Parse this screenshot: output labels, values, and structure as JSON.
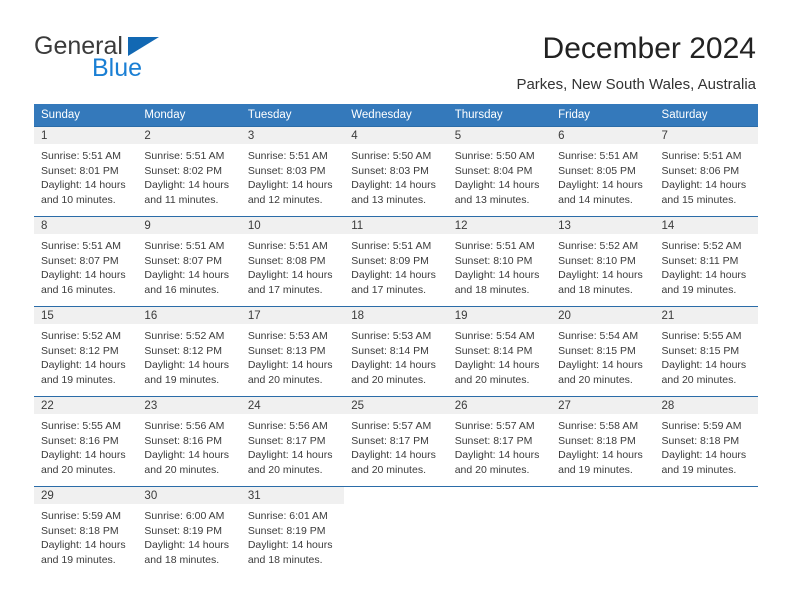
{
  "brand": {
    "name_line1": "General",
    "name_line2": "Blue",
    "flag_icon": "triangle-flag-icon",
    "accent_color": "#1a7fd4"
  },
  "header": {
    "title": "December 2024",
    "subtitle": "Parkes, New South Wales, Australia"
  },
  "theme": {
    "header_row_bg": "#3479bb",
    "day_number_bg": "#f0f0f0",
    "row_border": "#2b6ca8"
  },
  "calendar": {
    "weekday_headers": [
      "Sunday",
      "Monday",
      "Tuesday",
      "Wednesday",
      "Thursday",
      "Friday",
      "Saturday"
    ],
    "weeks": [
      [
        {
          "day": "1",
          "sunrise": "Sunrise: 5:51 AM",
          "sunset": "Sunset: 8:01 PM",
          "daylight_line1": "Daylight: 14 hours",
          "daylight_line2": "and 10 minutes."
        },
        {
          "day": "2",
          "sunrise": "Sunrise: 5:51 AM",
          "sunset": "Sunset: 8:02 PM",
          "daylight_line1": "Daylight: 14 hours",
          "daylight_line2": "and 11 minutes."
        },
        {
          "day": "3",
          "sunrise": "Sunrise: 5:51 AM",
          "sunset": "Sunset: 8:03 PM",
          "daylight_line1": "Daylight: 14 hours",
          "daylight_line2": "and 12 minutes."
        },
        {
          "day": "4",
          "sunrise": "Sunrise: 5:50 AM",
          "sunset": "Sunset: 8:03 PM",
          "daylight_line1": "Daylight: 14 hours",
          "daylight_line2": "and 13 minutes."
        },
        {
          "day": "5",
          "sunrise": "Sunrise: 5:50 AM",
          "sunset": "Sunset: 8:04 PM",
          "daylight_line1": "Daylight: 14 hours",
          "daylight_line2": "and 13 minutes."
        },
        {
          "day": "6",
          "sunrise": "Sunrise: 5:51 AM",
          "sunset": "Sunset: 8:05 PM",
          "daylight_line1": "Daylight: 14 hours",
          "daylight_line2": "and 14 minutes."
        },
        {
          "day": "7",
          "sunrise": "Sunrise: 5:51 AM",
          "sunset": "Sunset: 8:06 PM",
          "daylight_line1": "Daylight: 14 hours",
          "daylight_line2": "and 15 minutes."
        }
      ],
      [
        {
          "day": "8",
          "sunrise": "Sunrise: 5:51 AM",
          "sunset": "Sunset: 8:07 PM",
          "daylight_line1": "Daylight: 14 hours",
          "daylight_line2": "and 16 minutes."
        },
        {
          "day": "9",
          "sunrise": "Sunrise: 5:51 AM",
          "sunset": "Sunset: 8:07 PM",
          "daylight_line1": "Daylight: 14 hours",
          "daylight_line2": "and 16 minutes."
        },
        {
          "day": "10",
          "sunrise": "Sunrise: 5:51 AM",
          "sunset": "Sunset: 8:08 PM",
          "daylight_line1": "Daylight: 14 hours",
          "daylight_line2": "and 17 minutes."
        },
        {
          "day": "11",
          "sunrise": "Sunrise: 5:51 AM",
          "sunset": "Sunset: 8:09 PM",
          "daylight_line1": "Daylight: 14 hours",
          "daylight_line2": "and 17 minutes."
        },
        {
          "day": "12",
          "sunrise": "Sunrise: 5:51 AM",
          "sunset": "Sunset: 8:10 PM",
          "daylight_line1": "Daylight: 14 hours",
          "daylight_line2": "and 18 minutes."
        },
        {
          "day": "13",
          "sunrise": "Sunrise: 5:52 AM",
          "sunset": "Sunset: 8:10 PM",
          "daylight_line1": "Daylight: 14 hours",
          "daylight_line2": "and 18 minutes."
        },
        {
          "day": "14",
          "sunrise": "Sunrise: 5:52 AM",
          "sunset": "Sunset: 8:11 PM",
          "daylight_line1": "Daylight: 14 hours",
          "daylight_line2": "and 19 minutes."
        }
      ],
      [
        {
          "day": "15",
          "sunrise": "Sunrise: 5:52 AM",
          "sunset": "Sunset: 8:12 PM",
          "daylight_line1": "Daylight: 14 hours",
          "daylight_line2": "and 19 minutes."
        },
        {
          "day": "16",
          "sunrise": "Sunrise: 5:52 AM",
          "sunset": "Sunset: 8:12 PM",
          "daylight_line1": "Daylight: 14 hours",
          "daylight_line2": "and 19 minutes."
        },
        {
          "day": "17",
          "sunrise": "Sunrise: 5:53 AM",
          "sunset": "Sunset: 8:13 PM",
          "daylight_line1": "Daylight: 14 hours",
          "daylight_line2": "and 20 minutes."
        },
        {
          "day": "18",
          "sunrise": "Sunrise: 5:53 AM",
          "sunset": "Sunset: 8:14 PM",
          "daylight_line1": "Daylight: 14 hours",
          "daylight_line2": "and 20 minutes."
        },
        {
          "day": "19",
          "sunrise": "Sunrise: 5:54 AM",
          "sunset": "Sunset: 8:14 PM",
          "daylight_line1": "Daylight: 14 hours",
          "daylight_line2": "and 20 minutes."
        },
        {
          "day": "20",
          "sunrise": "Sunrise: 5:54 AM",
          "sunset": "Sunset: 8:15 PM",
          "daylight_line1": "Daylight: 14 hours",
          "daylight_line2": "and 20 minutes."
        },
        {
          "day": "21",
          "sunrise": "Sunrise: 5:55 AM",
          "sunset": "Sunset: 8:15 PM",
          "daylight_line1": "Daylight: 14 hours",
          "daylight_line2": "and 20 minutes."
        }
      ],
      [
        {
          "day": "22",
          "sunrise": "Sunrise: 5:55 AM",
          "sunset": "Sunset: 8:16 PM",
          "daylight_line1": "Daylight: 14 hours",
          "daylight_line2": "and 20 minutes."
        },
        {
          "day": "23",
          "sunrise": "Sunrise: 5:56 AM",
          "sunset": "Sunset: 8:16 PM",
          "daylight_line1": "Daylight: 14 hours",
          "daylight_line2": "and 20 minutes."
        },
        {
          "day": "24",
          "sunrise": "Sunrise: 5:56 AM",
          "sunset": "Sunset: 8:17 PM",
          "daylight_line1": "Daylight: 14 hours",
          "daylight_line2": "and 20 minutes."
        },
        {
          "day": "25",
          "sunrise": "Sunrise: 5:57 AM",
          "sunset": "Sunset: 8:17 PM",
          "daylight_line1": "Daylight: 14 hours",
          "daylight_line2": "and 20 minutes."
        },
        {
          "day": "26",
          "sunrise": "Sunrise: 5:57 AM",
          "sunset": "Sunset: 8:17 PM",
          "daylight_line1": "Daylight: 14 hours",
          "daylight_line2": "and 20 minutes."
        },
        {
          "day": "27",
          "sunrise": "Sunrise: 5:58 AM",
          "sunset": "Sunset: 8:18 PM",
          "daylight_line1": "Daylight: 14 hours",
          "daylight_line2": "and 19 minutes."
        },
        {
          "day": "28",
          "sunrise": "Sunrise: 5:59 AM",
          "sunset": "Sunset: 8:18 PM",
          "daylight_line1": "Daylight: 14 hours",
          "daylight_line2": "and 19 minutes."
        }
      ],
      [
        {
          "day": "29",
          "sunrise": "Sunrise: 5:59 AM",
          "sunset": "Sunset: 8:18 PM",
          "daylight_line1": "Daylight: 14 hours",
          "daylight_line2": "and 19 minutes."
        },
        {
          "day": "30",
          "sunrise": "Sunrise: 6:00 AM",
          "sunset": "Sunset: 8:19 PM",
          "daylight_line1": "Daylight: 14 hours",
          "daylight_line2": "and 18 minutes."
        },
        {
          "day": "31",
          "sunrise": "Sunrise: 6:01 AM",
          "sunset": "Sunset: 8:19 PM",
          "daylight_line1": "Daylight: 14 hours",
          "daylight_line2": "and 18 minutes."
        },
        {
          "day": "",
          "sunrise": "",
          "sunset": "",
          "daylight_line1": "",
          "daylight_line2": ""
        },
        {
          "day": "",
          "sunrise": "",
          "sunset": "",
          "daylight_line1": "",
          "daylight_line2": ""
        },
        {
          "day": "",
          "sunrise": "",
          "sunset": "",
          "daylight_line1": "",
          "daylight_line2": ""
        },
        {
          "day": "",
          "sunrise": "",
          "sunset": "",
          "daylight_line1": "",
          "daylight_line2": ""
        }
      ]
    ]
  }
}
